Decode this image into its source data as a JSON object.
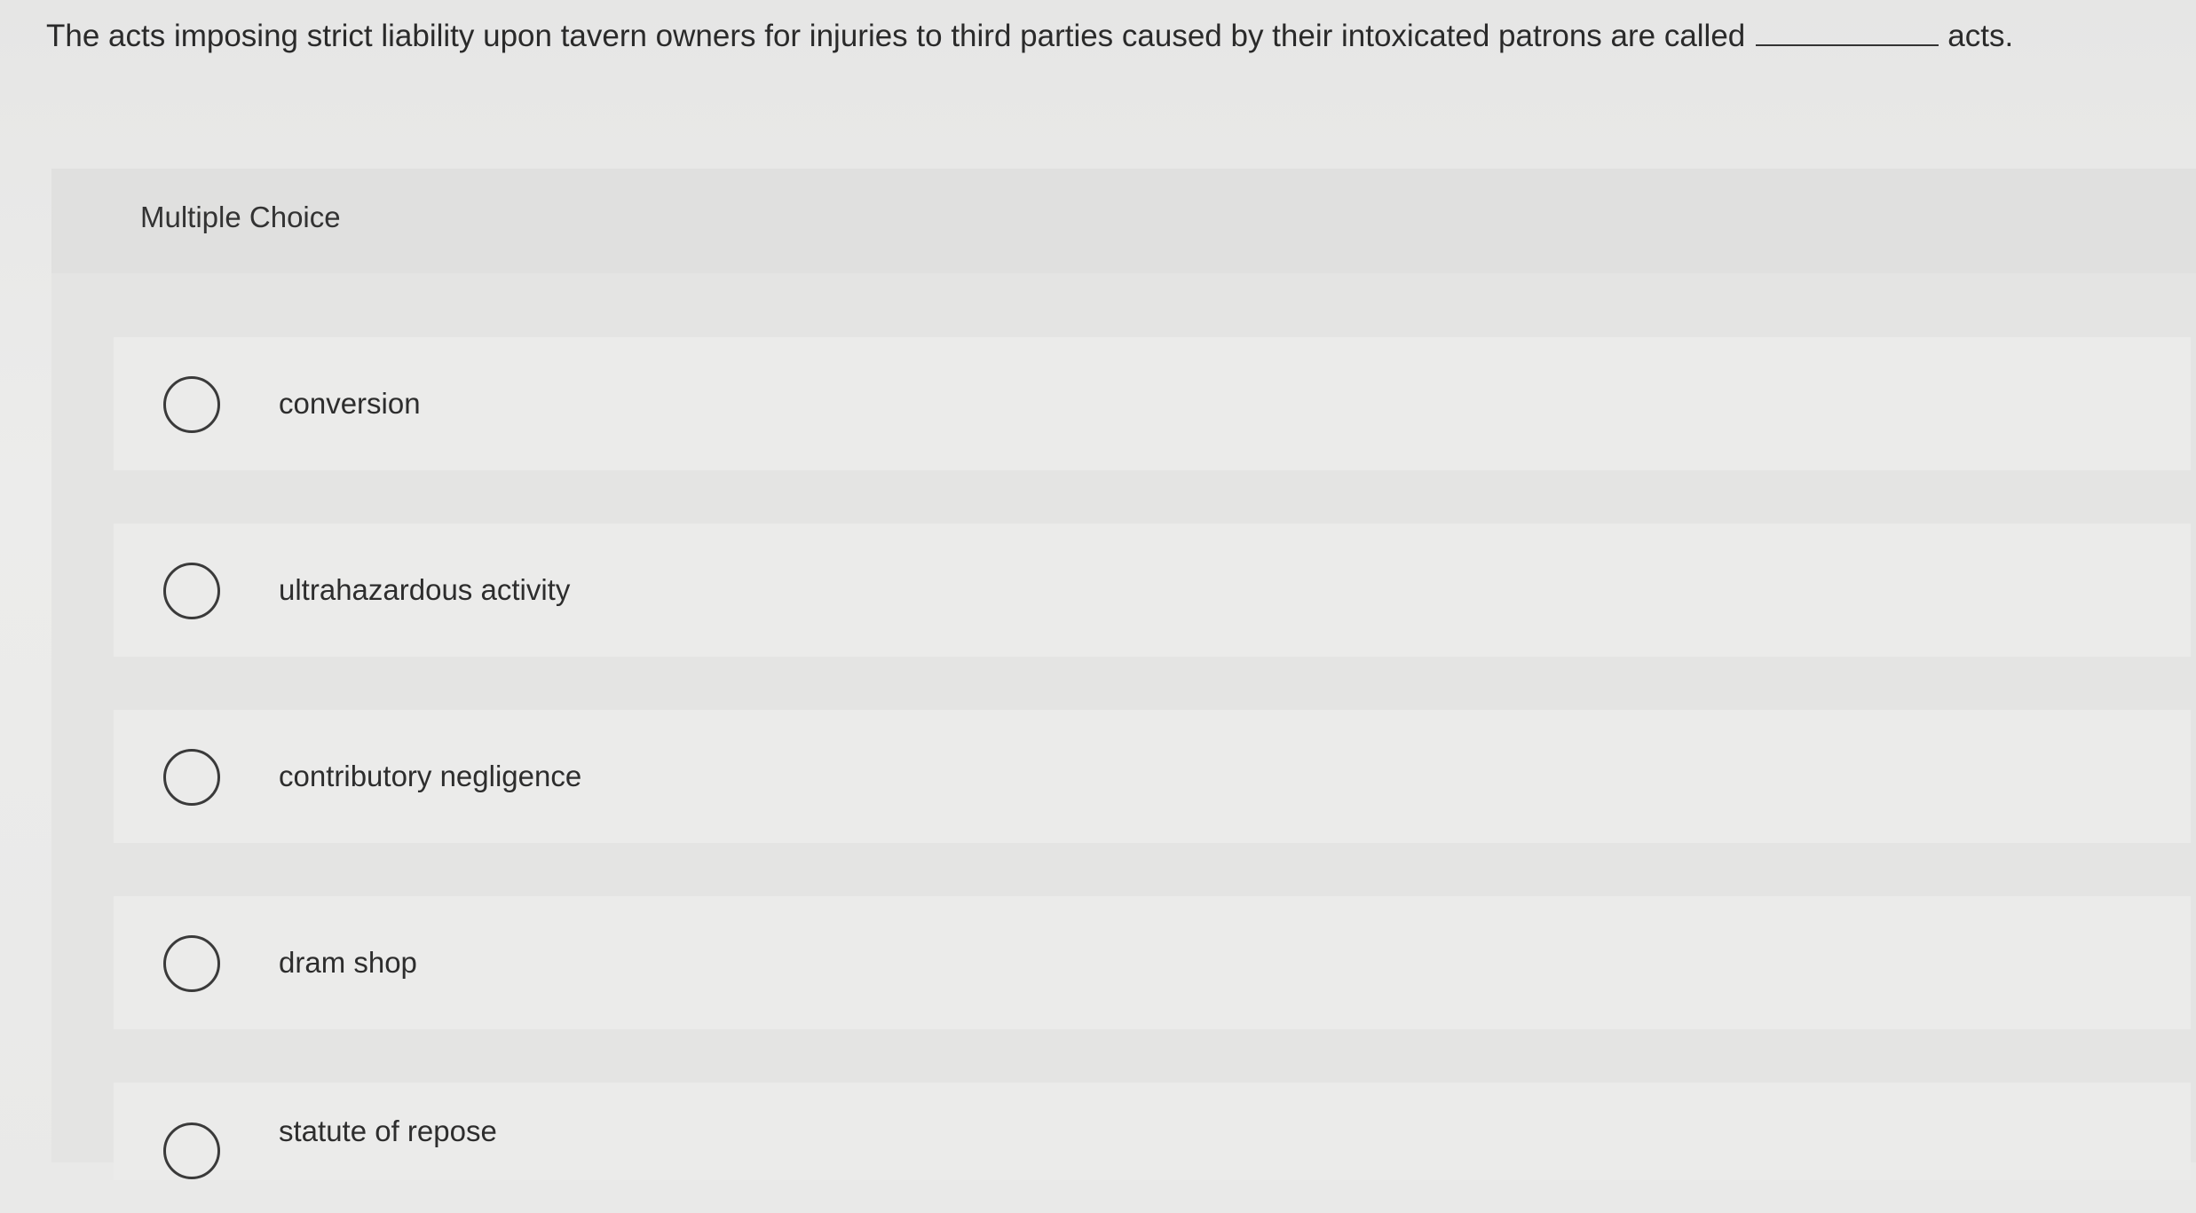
{
  "question": {
    "text": "The acts imposing strict liability upon tavern owners for injuries to third parties caused by their intoxicated patrons are called",
    "suffix": "acts."
  },
  "panel": {
    "title": "Multiple Choice"
  },
  "options": [
    {
      "label": "conversion",
      "selected": false
    },
    {
      "label": "ultrahazardous activity",
      "selected": false
    },
    {
      "label": "contributory negligence",
      "selected": false
    },
    {
      "label": "dram shop",
      "selected": false
    },
    {
      "label": "statute of repose",
      "selected": false
    }
  ]
}
